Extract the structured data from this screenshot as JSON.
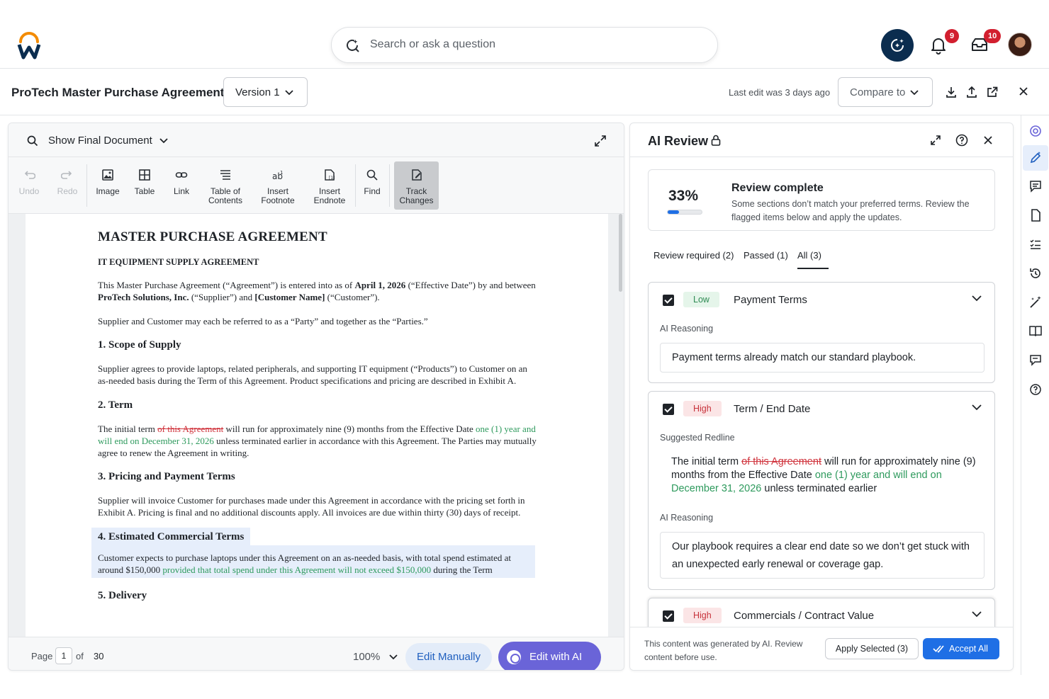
{
  "top": {
    "search_placeholder": "Search or ask a question",
    "notifications_count": "9",
    "inbox_count": "10"
  },
  "docbar": {
    "title": "ProTech Master Purchase Agreement",
    "version": "Version 1",
    "last_edit": "Last edit was 3 days ago",
    "compare": "Compare to"
  },
  "left": {
    "view_mode": "Show Final Document",
    "toolbar": {
      "undo": "Undo",
      "redo": "Redo",
      "image": "Image",
      "table": "Table",
      "link": "Link",
      "toc_1": "Table of",
      "toc_2": "Contents",
      "footnote_1": "Insert",
      "footnote_2": "Footnote",
      "endnote_1": "Insert",
      "endnote_2": "Endnote",
      "find": "Find",
      "track_1": "Track",
      "track_2": "Changes"
    },
    "doc": {
      "title": "MASTER PURCHASE AGREEMENT",
      "subtitle": "IT EQUIPMENT SUPPLY AGREEMENT",
      "intro_a": "This Master Purchase Agreement (“Agreement”) is entered into as of ",
      "intro_date": "April 1, 2026",
      "intro_b": " (“Effective Date”) by and between ",
      "intro_supplier": "ProTech Solutions, Inc.",
      "intro_c": " (“Supplier”) and ",
      "intro_customer": "[Customer Name]",
      "intro_d": " (“Customer”).",
      "parties": "Supplier and Customer may each be referred to as a “Party” and together as the “Parties.”",
      "s1_title": "1. Scope of Supply",
      "s1_text": "Supplier agrees to provide laptops, related peripherals, and supporting IT equipment (“Products”) to Customer on an as-needed basis during the Term of this Agreement. Product specifications and pricing are described in Exhibit A.",
      "s2_title": "2. Term",
      "s2_a": "The initial term ",
      "s2_del": "of this Agreement",
      "s2_b": " will run for approximately nine (9) months from the Effective Date ",
      "s2_ins": "one (1) year and will end on December 31, 2026",
      "s2_c": " unless terminated earlier in accordance with this Agreement. The Parties may mutually agree to renew the Agreement in writing.",
      "s3_title": "3. Pricing and Payment Terms",
      "s3_text": "Supplier will invoice Customer for purchases made under this Agreement in accordance with the pricing set forth in Exhibit A. Pricing is final and no additional discounts apply. All invoices are due within thirty (30) days of receipt.",
      "s4_title": "4. Estimated Commercial Terms",
      "s4_a": "Customer expects to purchase laptops under this Agreement on an as-needed basis, with total spend estimated at around $150,000 ",
      "s4_ins": "provided that total spend under this Agreement will not exceed $150,000",
      "s4_b": " during the Term",
      "s5_title": "5. Delivery"
    },
    "footer": {
      "page_label": "Page",
      "page_num": "1",
      "of": "of",
      "total": "30",
      "zoom": "100%",
      "edit_manually": "Edit Manually",
      "edit_ai": "Edit with AI"
    }
  },
  "review": {
    "title": "AI Review",
    "percent": "33%",
    "progress": 0.33,
    "status_title": "Review complete",
    "status_text": "Some sections don’t match your preferred terms. Review the flagged items below and apply the updates.",
    "tabs": [
      "Review required (2)",
      "Passed (1)",
      "All (3)"
    ],
    "items": [
      {
        "severity": "Low",
        "title": "Payment Terms",
        "reasoning_label": "AI Reasoning",
        "reasoning": "Payment terms already match our standard playbook."
      },
      {
        "severity": "High",
        "title": "Term / End Date",
        "redline_label": "Suggested Redline",
        "redline_a": "The initial term ",
        "redline_del": "of this Agreement",
        "redline_b": " will run for approximately nine (9) months from the Effective Date ",
        "redline_ins": "one (1) year and will end on December 31, 2026",
        "redline_c": " unless terminated earlier",
        "reasoning_label": "AI Reasoning",
        "reasoning": "Our playbook requires a clear end date so we don’t get stuck with an unexpected early renewal or coverage gap."
      },
      {
        "severity": "High",
        "title": "Commercials / Contract Value"
      }
    ],
    "footer": {
      "disclaimer": "This content was generated by AI. Review content before use.",
      "apply_selected": "Apply Selected (3)",
      "accept_all": "Accept All"
    }
  },
  "colors": {
    "accent": "#1f6fe5",
    "ai_purple": "#6a64d8",
    "deleted": "#d0343d",
    "inserted": "#2e9a5d",
    "brand_navy": "#0b2d4f",
    "brand_orange": "#f38b00"
  }
}
